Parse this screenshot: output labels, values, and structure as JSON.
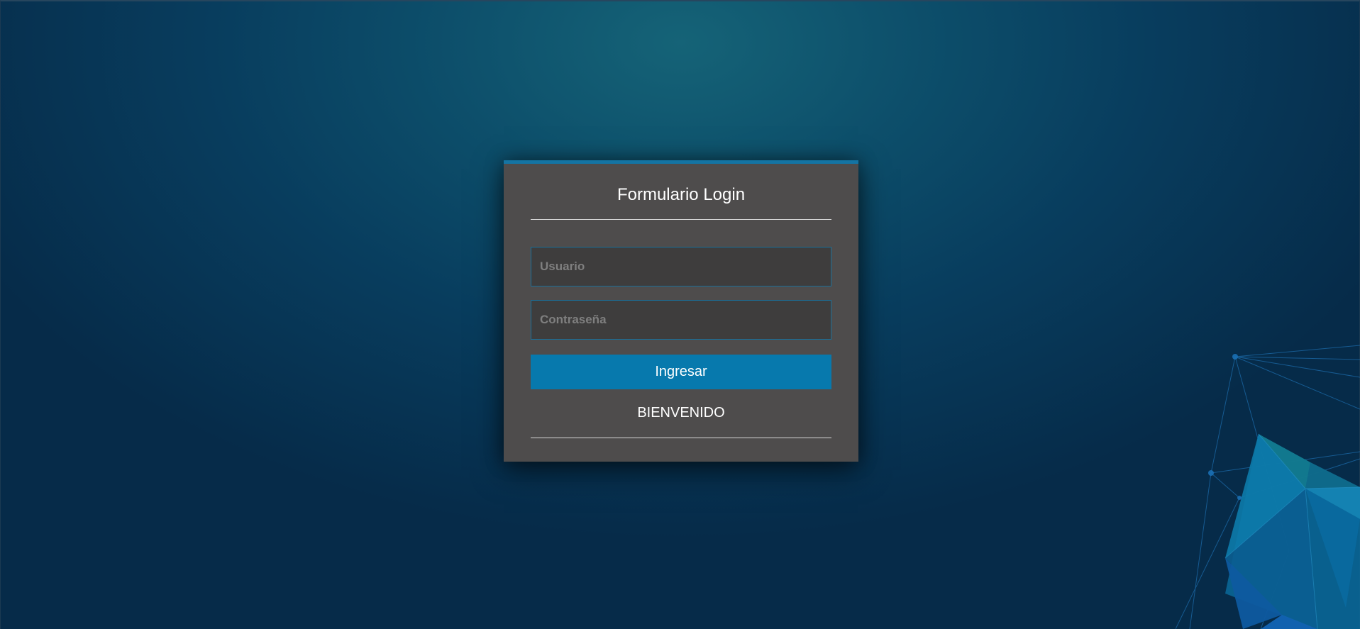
{
  "login": {
    "title": "Formulario Login",
    "username_placeholder": "Usuario",
    "password_placeholder": "Contraseña",
    "submit_label": "Ingresar",
    "welcome_text": "BIENVENIDO"
  },
  "colors": {
    "accent": "#0779ad",
    "card_background": "#4e4c4c",
    "input_background": "#3e3d3d",
    "page_background": "#0a4463"
  }
}
